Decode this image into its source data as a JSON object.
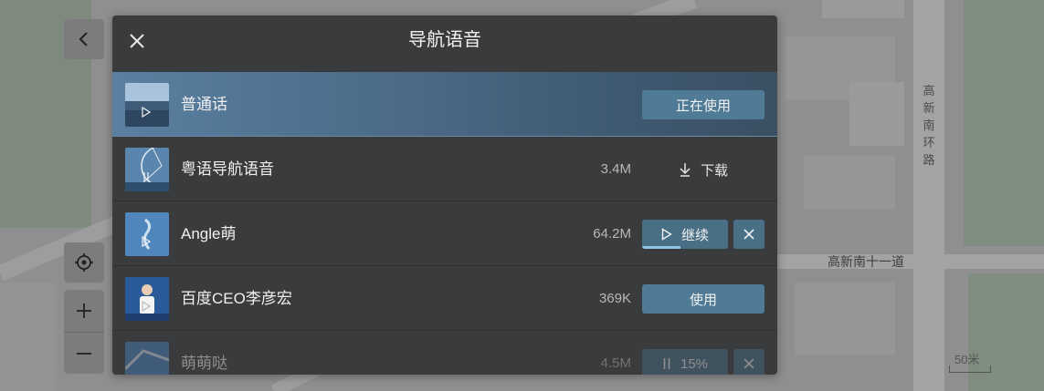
{
  "map": {
    "road_vertical": "高新南环路",
    "road_horizontal": "高新南十一道",
    "scale": "50米"
  },
  "controls": {
    "back_icon": "chevron-left-icon",
    "locate_icon": "locate-icon",
    "zoom_in_icon": "plus-icon",
    "zoom_out_icon": "minus-icon"
  },
  "dialog": {
    "title": "导航语音",
    "close_icon": "close-icon",
    "voices": [
      {
        "name": "普通话",
        "size": "",
        "action": "正在使用",
        "state": "in-use"
      },
      {
        "name": "粤语导航语音",
        "size": "3.4M",
        "action": "下载",
        "state": "download",
        "icon": "download-icon"
      },
      {
        "name": "Angle萌",
        "size": "64.2M",
        "action": "继续",
        "state": "paused",
        "icon": "play-icon",
        "progress": 0.45
      },
      {
        "name": "百度CEO李彦宏",
        "size": "369K",
        "action": "使用",
        "state": "downloaded"
      },
      {
        "name": "萌萌哒",
        "size": "4.5M",
        "action": "15%",
        "state": "downloading",
        "icon": "pause-icon",
        "progress": 0.15
      }
    ]
  },
  "colors": {
    "dialog_bg": "#3a3b3d",
    "accent": "#4f7b96",
    "selected_row": "#4e6f8c",
    "map_bg": "#8e8e8e"
  }
}
